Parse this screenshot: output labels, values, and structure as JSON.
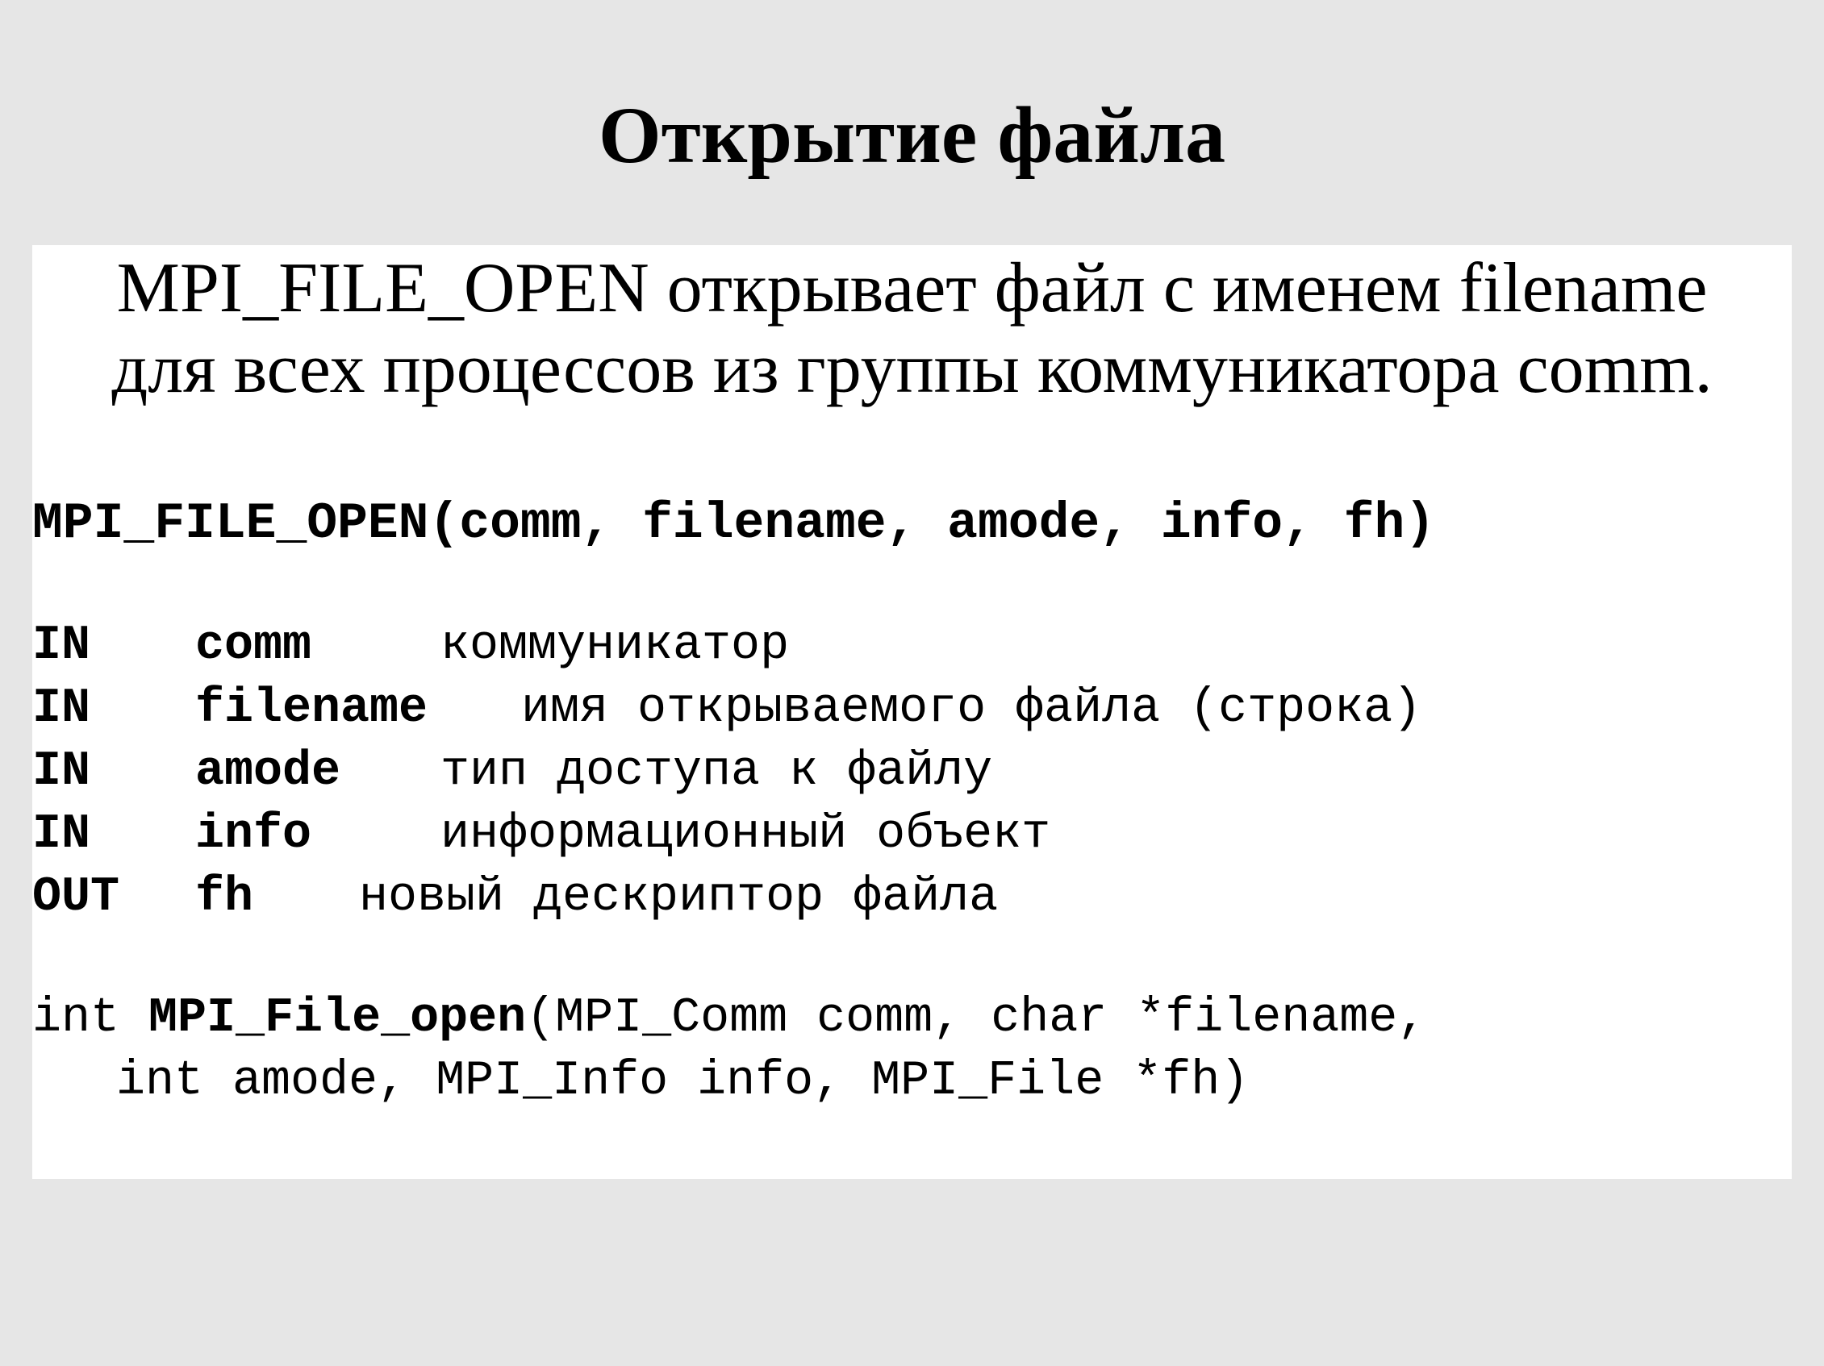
{
  "slide": {
    "title": "Открытие файла",
    "intro_line1": "MPI_FILE_OPEN открывает файл с именем filename",
    "intro_line2": "для всех процессов из группы коммуникатора comm."
  },
  "signature": "MPI_FILE_OPEN(comm, filename, amode, info, fh)",
  "params": [
    {
      "dir": "IN",
      "name": "comm",
      "desc": "коммуникатор"
    },
    {
      "dir": "IN",
      "name": "filename",
      "desc": "имя открываемого файла (строка)"
    },
    {
      "dir": "IN",
      "name": "amode",
      "desc": "тип доступа к файлу"
    },
    {
      "dir": "IN",
      "name": "info",
      "desc": "информационный объект"
    },
    {
      "dir": "OUT",
      "name": "fh",
      "desc": "новый дескриптор файла"
    }
  ],
  "c_binding": {
    "return_type": "int ",
    "function": "MPI_File_open",
    "args_line1": "(MPI_Comm comm, char *filename,",
    "args_line2": "int amode, MPI_Info info, MPI_File *fh)"
  }
}
